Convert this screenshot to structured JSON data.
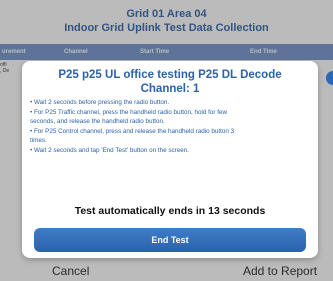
{
  "header": {
    "line1": "Grid 01 Area 04",
    "line2": "Indoor Grid Uplink Test Data Collection"
  },
  "table": {
    "columns": [
      "urement",
      "Channel",
      "Start Time",
      "End Time"
    ],
    "row_fragment": [
      "offi",
      ", De"
    ]
  },
  "footer": {
    "cancel_label": "Cancel",
    "add_label": "Add to Report"
  },
  "dialog": {
    "title": "P25 p25 UL office testing P25 DL Decode",
    "subtitle": "Channel: 1",
    "instructions": [
      "• Wait 2 seconds before pressing the radio button.",
      "• For P25 Traffic channel, press the handheld radio button, hold for few",
      "seconds, and release the handheld radio button.",
      "• For P25 Control channel, press and release the handheld radio button 3",
      "times.",
      "• Wait 2 seconds and tap 'End Test' button on the screen."
    ],
    "countdown_text": "Test automatically ends in 13 seconds",
    "end_button_label": "End Test"
  },
  "colors": {
    "accent": "#2b62a8",
    "table_header": "#6f93c9",
    "button": "#2a62ac"
  }
}
